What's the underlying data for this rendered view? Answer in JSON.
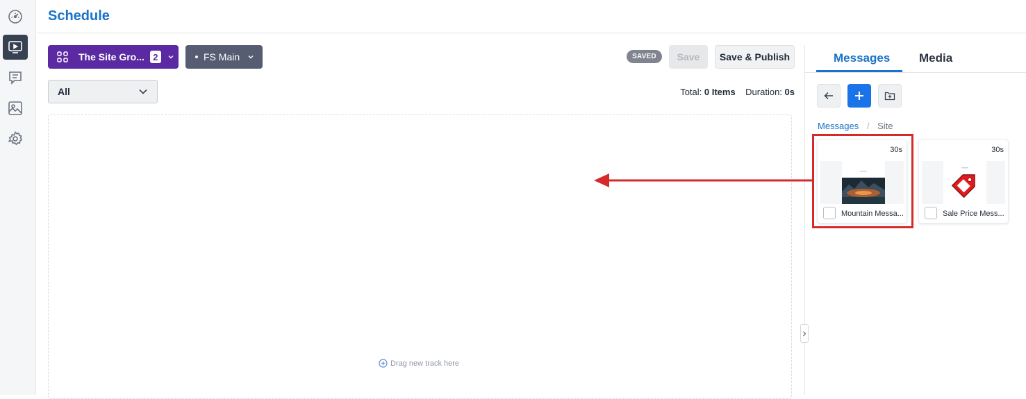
{
  "header": {
    "title": "Schedule"
  },
  "rail": {
    "items": [
      "dashboard-icon",
      "screens-icon",
      "messages-icon",
      "media-icon",
      "settings-icon"
    ],
    "active": "screens-icon"
  },
  "toolbar": {
    "site_group_label": "The Site Gro...",
    "site_group_count": "2",
    "channel_label": "FS Main",
    "saved_badge": "SAVED",
    "save_label": "Save",
    "publish_label": "Save & Publish"
  },
  "filter": {
    "selected": "All"
  },
  "totals": {
    "total_label": "Total:",
    "total_value": "0 Items",
    "duration_label": "Duration:",
    "duration_value": "0s"
  },
  "dropzone": {
    "hint": "Drag new track here"
  },
  "panel": {
    "tabs": [
      {
        "label": "Messages",
        "active": true
      },
      {
        "label": "Media",
        "active": false
      }
    ],
    "breadcrumb": {
      "root": "Messages",
      "current": "Site"
    },
    "items": [
      {
        "name": "Mountain Messa...",
        "duration": "30s",
        "highlighted": true
      },
      {
        "name": "Sale Price Mess...",
        "duration": "30s",
        "highlighted": false
      }
    ]
  },
  "colors": {
    "accent": "#1a73c8",
    "site_group": "#5b2aa3",
    "highlight": "#d62a2a"
  }
}
